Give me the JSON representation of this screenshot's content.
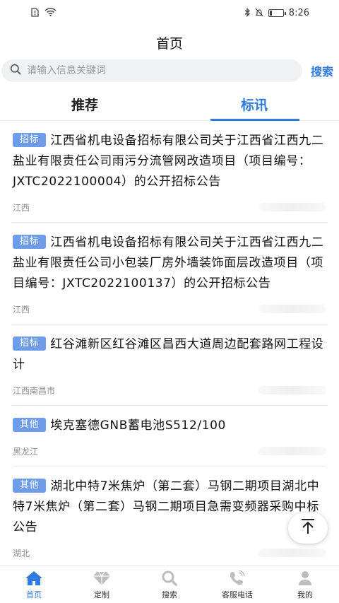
{
  "status": {
    "time": "8:26",
    "icons": [
      "sim-icon",
      "wifi-icon",
      "bluetooth-icon",
      "mute-icon",
      "battery-icon"
    ],
    "battery_level": 0.2
  },
  "page": {
    "title": "首页"
  },
  "search": {
    "placeholder": "请输入信息关键词",
    "button": "搜索"
  },
  "tabs": [
    {
      "label": "推荐",
      "active": false
    },
    {
      "label": "标讯",
      "active": true
    }
  ],
  "items": [
    {
      "tag": "招标",
      "title": "江西省机电设备招标有限公司关于江西省江西九二盐业有限责任公司雨污分流管网改造项目（项目编号：JXTC2022100004）的公开招标公告",
      "region": "江西"
    },
    {
      "tag": "招标",
      "title": "江西省机电设备招标有限公司关于江西省江西九二盐业有限责任公司小包装厂房外墙装饰面层改造项目（项目编号：JXTC2022100137）的公开招标公告",
      "region": "江西"
    },
    {
      "tag": "招标",
      "title": "红谷滩新区红谷滩区昌西大道周边配套路网工程设计",
      "region": "江西南昌市"
    },
    {
      "tag": "其他",
      "title": "埃克塞德GNB蓄电池S512/100",
      "region": "黑龙江"
    },
    {
      "tag": "其他",
      "title": "湖北中特7米焦炉（第二套）马钢二期项目湖北中特7米焦炉（第二套）马钢二期项目急需变频器采购中标公告",
      "region": "湖北"
    }
  ],
  "bottom_nav": [
    {
      "label": "首页",
      "icon": "home-icon",
      "active": true
    },
    {
      "label": "定制",
      "icon": "diamond-icon",
      "active": false
    },
    {
      "label": "搜索",
      "icon": "search-icon",
      "active": false
    },
    {
      "label": "客服电话",
      "icon": "phone-icon",
      "active": false
    },
    {
      "label": "我的",
      "icon": "user-icon",
      "active": false
    }
  ],
  "colors": {
    "accent": "#2f7be0",
    "tag": "#6e9ce8"
  }
}
